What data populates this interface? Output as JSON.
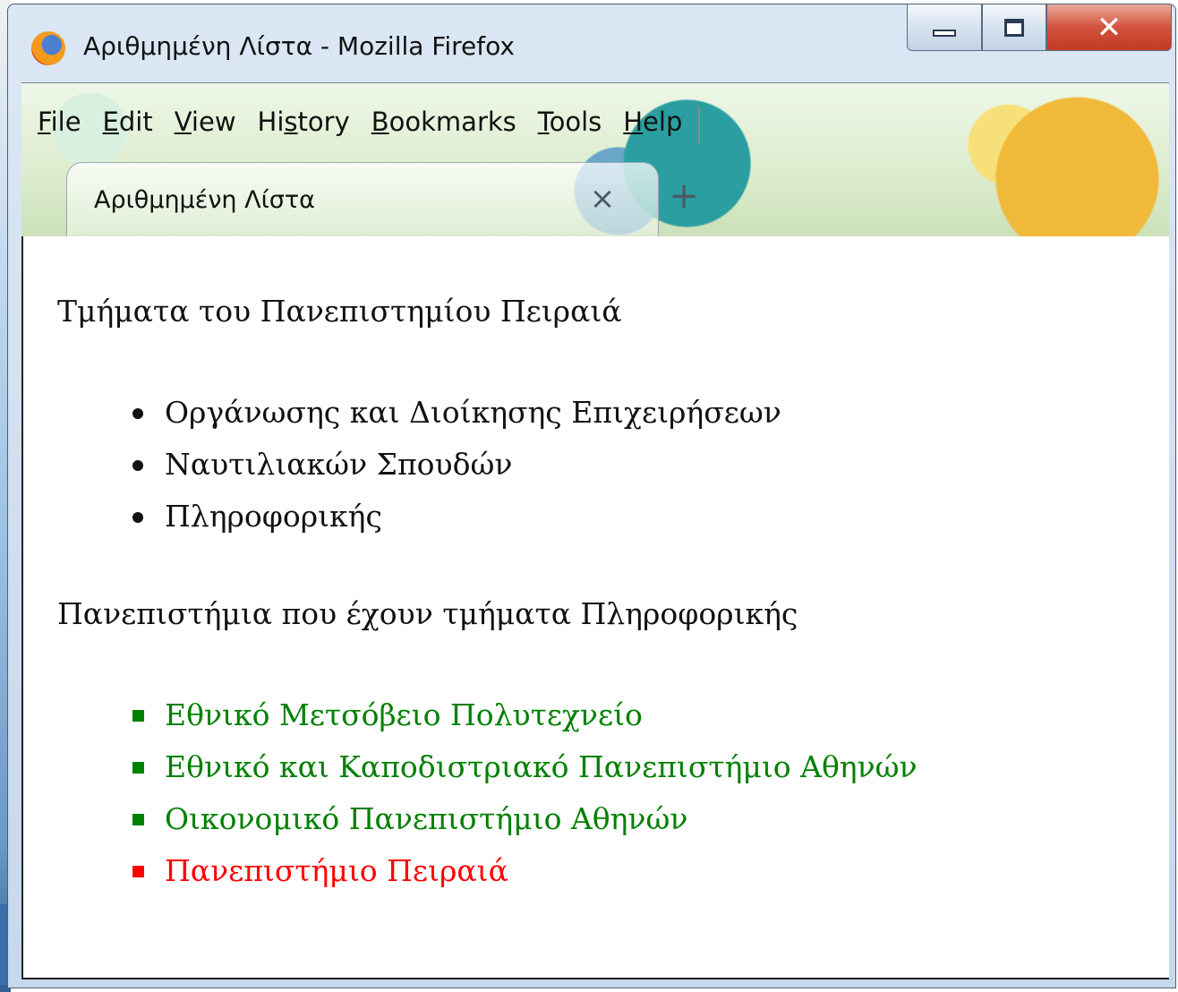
{
  "window": {
    "title": "Αριθμημένη Λίστα - Mozilla Firefox"
  },
  "menu": [
    {
      "pre": "",
      "u": "F",
      "post": "ile"
    },
    {
      "pre": "",
      "u": "E",
      "post": "dit"
    },
    {
      "pre": "",
      "u": "V",
      "post": "iew"
    },
    {
      "pre": "Hi",
      "u": "s",
      "post": "tory"
    },
    {
      "pre": "",
      "u": "B",
      "post": "ookmarks"
    },
    {
      "pre": "",
      "u": "T",
      "post": "ools"
    },
    {
      "pre": "",
      "u": "H",
      "post": "elp"
    }
  ],
  "tab": {
    "label": "Αριθμημένη Λίστα"
  },
  "content": {
    "heading1": "Τμήματα του Πανεπιστημίου Πειραιά",
    "list1": [
      "Οργάνωσης και Διοίκησης Επιχειρήσεων",
      "Ναυτιλιακών Σπουδών",
      "Πληροφορικής"
    ],
    "heading2": "Πανεπιστήμια που έχουν τμήματα Πληροφορικής",
    "list2": [
      {
        "text": "Εθνικό Μετσόβειο Πολυτεχνείο",
        "color": "#008000"
      },
      {
        "text": "Εθνικό και Καποδιστριακό Πανεπιστήμιο Αθηνών",
        "color": "#008000"
      },
      {
        "text": "Οικονομικό Πανεπιστήμιο Αθηνών",
        "color": "#008000"
      },
      {
        "text": "Πανεπιστήμιο Πειραιά",
        "color": "#ff0000"
      }
    ]
  }
}
